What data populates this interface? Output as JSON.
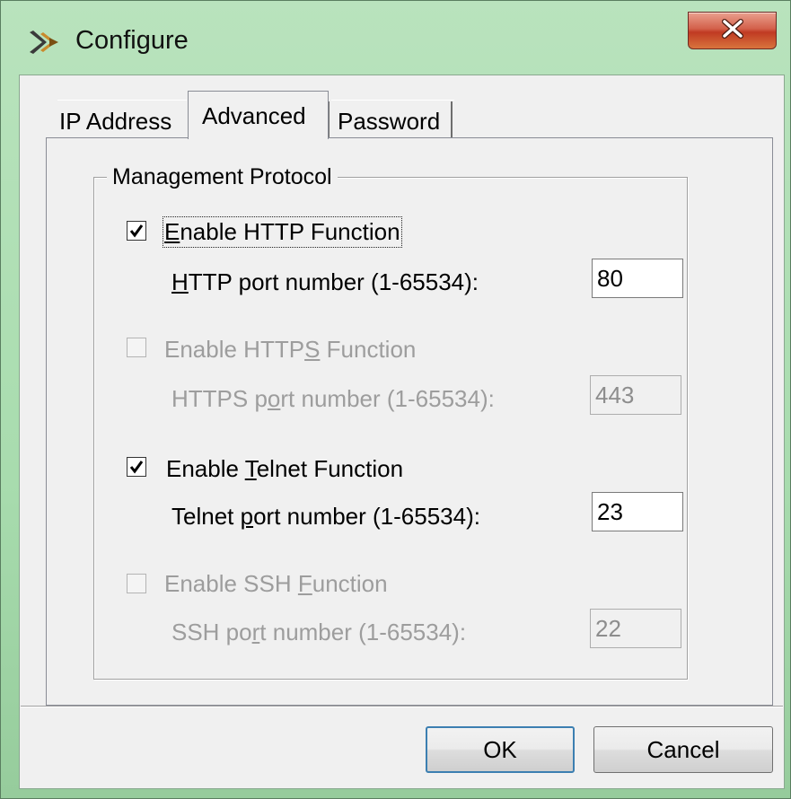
{
  "window": {
    "title": "Configure",
    "close_glyph": "X",
    "icon": "tools-icon"
  },
  "tabs": [
    {
      "label": "IP Address",
      "active": false
    },
    {
      "label": "Advanced",
      "active": true
    },
    {
      "label": "Password",
      "active": false
    }
  ],
  "group": {
    "title": "Management Protocol"
  },
  "http": {
    "enable_pre": "",
    "enable_mnemonic": "E",
    "enable_post": "nable HTTP Function",
    "checked": true,
    "port_pre": "",
    "port_mnemonic": "H",
    "port_post": "TTP port number (1-65534):",
    "port_value": "80"
  },
  "https": {
    "enable_pre": "Enable HTTP",
    "enable_mnemonic": "S",
    "enable_post": " Function",
    "checked": false,
    "port_pre": "HTTPS p",
    "port_mnemonic": "o",
    "port_post": "rt number (1-65534):",
    "port_value": "443"
  },
  "telnet": {
    "enable_pre": "Enable ",
    "enable_mnemonic": "T",
    "enable_post": "elnet Function",
    "checked": true,
    "port_pre": "Telnet ",
    "port_mnemonic": "p",
    "port_post": "ort number (1-65534):",
    "port_value": "23"
  },
  "ssh": {
    "enable_pre": "Enable SSH ",
    "enable_mnemonic": "F",
    "enable_post": "unction",
    "checked": false,
    "port_pre": "SSH po",
    "port_mnemonic": "r",
    "port_post": "t number (1-65534):",
    "port_value": "22"
  },
  "buttons": {
    "ok": "OK",
    "cancel": "Cancel"
  },
  "colors": {
    "titlebar": "#a8dcae",
    "close_button": "#c03a22",
    "default_button_border": "#3c7fb1"
  }
}
